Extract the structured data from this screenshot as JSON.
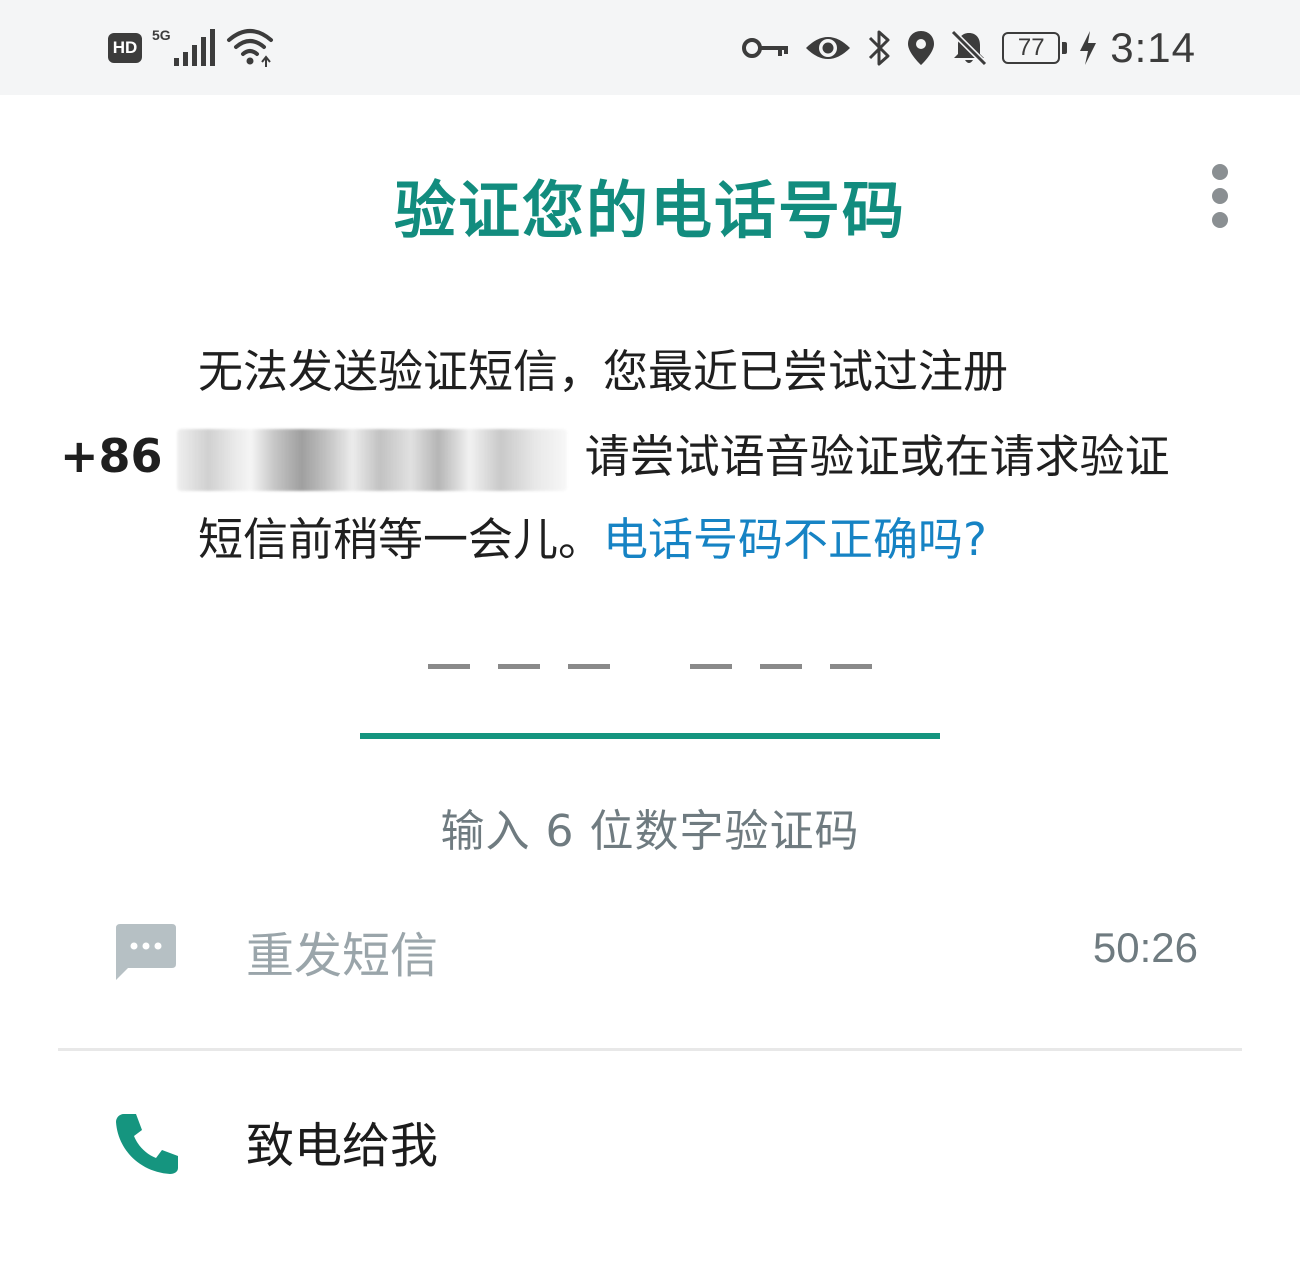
{
  "status_bar": {
    "hd_label": "HD",
    "network_label": "5G",
    "battery_level": "77",
    "time": "3:14",
    "icons": [
      "hd-icon",
      "signal-icon",
      "wifi-icon",
      "key-icon",
      "eye-icon",
      "bluetooth-icon",
      "location-icon",
      "bell-off-icon",
      "battery-icon",
      "charging-icon"
    ]
  },
  "header": {
    "title": "验证您的电话号码",
    "menu_icon": "more-vert-icon"
  },
  "message": {
    "line1": "无法发送验证短信，您最近已尝试过注册",
    "phone_prefix": "+86",
    "line2_rest": "请尝试语音验证或在请求验证",
    "line3_text": "短信前稍等一会儿。",
    "wrong_number_link": "电话号码不正确吗?"
  },
  "code_input": {
    "digits": 6,
    "hint": "输入 6 位数字验证码"
  },
  "actions": {
    "resend": {
      "label": "重发短信",
      "timer": "50:26",
      "icon": "sms-icon",
      "enabled": false
    },
    "call": {
      "label": "致电给我",
      "icon": "phone-icon"
    }
  },
  "colors": {
    "accent": "#128c7e",
    "underline": "#15957f",
    "link": "#1683c4",
    "muted": "#9aa5aa"
  }
}
